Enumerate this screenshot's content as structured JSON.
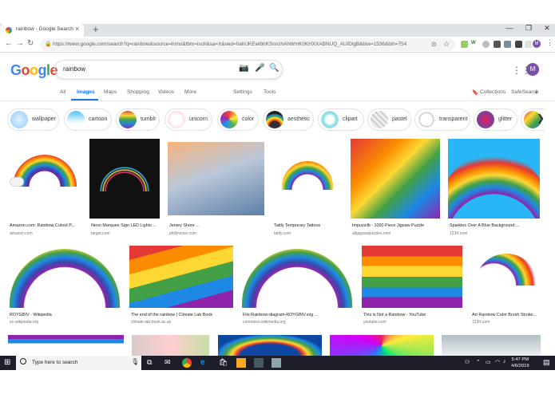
{
  "browser": {
    "tab_title": "rainbow - Google Search",
    "new_tab": "+",
    "close_tab": "×",
    "url": "https://www.google.com/search?q=rainbow&source=lnms&tbm=isch&sa=X&ved=0ahUKEwibhKSnnzhAhWmK0KHXXABNUQ_AUIDigB&biw=1536&bih=754",
    "profile_initial": "M"
  },
  "google": {
    "logo": "Google",
    "query": "rainbow",
    "avatar_initial": "M",
    "tabs": [
      "All",
      "Images",
      "Maps",
      "Shopping",
      "Videos",
      "More"
    ],
    "active_tab": "Images",
    "settings_label": "Settings",
    "tools_label": "Tools",
    "collections_label": "Collections",
    "safesearch_label": "SafeSearch"
  },
  "chips": [
    {
      "label": "wallpaper"
    },
    {
      "label": "cartoon"
    },
    {
      "label": "tumblr"
    },
    {
      "label": "unicorn"
    },
    {
      "label": "color"
    },
    {
      "label": "aesthetic"
    },
    {
      "label": "clipart"
    },
    {
      "label": "pastel"
    },
    {
      "label": "transparent"
    },
    {
      "label": "glitter"
    }
  ],
  "results_row1": [
    {
      "title": "Amazon.com: Rainbow Cutout P...",
      "source": "amazon.com"
    },
    {
      "title": "Neon Marquee Sign LED Lights ...",
      "source": "target.com"
    },
    {
      "title": "Jersey Shore ...",
      "source": "phillyvoice.com"
    },
    {
      "title": "Tattly Temporary Tattoos",
      "source": "tattly.com"
    },
    {
      "title": "Impuzzilb - 1000 Piece Jigsaw Puzzle",
      "source": "allgigsawpuzzles.com"
    },
    {
      "title": "Sparkles Over A Blue Background:...",
      "source": "123rf.com"
    }
  ],
  "results_row2": [
    {
      "title": "ROYGBIV - Wikipedia",
      "source": "en.wikipedia.org"
    },
    {
      "title": "The end of the rainbow | Climate Lab Book",
      "source": "climate-lab-book.ac.uk"
    },
    {
      "title": "File:Rainbow-diagram-ROYGBIV.svg ...",
      "source": "commons.wikimedia.org"
    },
    {
      "title": "This is Not a Rainbow - YouTube",
      "source": "youtube.com"
    },
    {
      "title": "Art Rainbow Color Brush Stroke...",
      "source": "123rf.com"
    }
  ],
  "taskbar": {
    "search_placeholder": "Type here to search",
    "time": "5:47 PM",
    "date": "4/6/2019"
  },
  "colors": {
    "google_blue": "#4285f4",
    "google_red": "#ea4335",
    "google_yellow": "#fbbc05",
    "google_green": "#34a853",
    "active_tab_blue": "#1a73e8"
  }
}
